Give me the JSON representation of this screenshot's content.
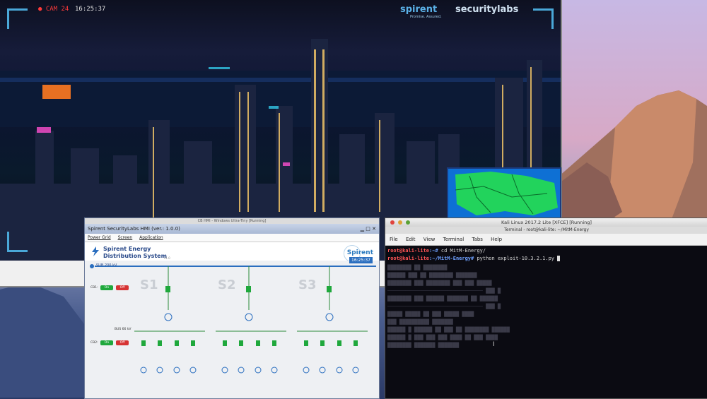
{
  "camera": {
    "rec_label": "CAM 24",
    "clock": "16:25:37",
    "brand_left": "spirent",
    "brand_left_sub": "Promise. Assured.",
    "brand_right": "securitylabs"
  },
  "hmi_window": {
    "outer_title": "CB HMI - Windows Ultra-Tiny [Running]",
    "app_title": "Spirent SecurityLabs HMI (ver.: 1.0.0)",
    "menu": [
      "Power Grid",
      "Screen",
      "Application"
    ],
    "system_title_line1": "Spirent Energy",
    "system_title_line2": "Distribution System",
    "system_version": "v1.0",
    "brand": "Spirent",
    "bus_main_label": "SUB 200 kV",
    "clock": "16:25:37",
    "stations": [
      "S1",
      "S2",
      "S3"
    ],
    "cb1_label": "CB1:",
    "cb2_label": "CB2:",
    "bus_secondary_label": "BUS 66 kV",
    "btn_on": "On",
    "btn_off": "Off"
  },
  "terminal": {
    "window_title": "Kali Linux 2017.2 Lite [XFCE] [Running]",
    "inner_title": "Terminal - root@kali-lite: ~/MitM-Energy",
    "menu": [
      "File",
      "Edit",
      "View",
      "Terminal",
      "Tabs",
      "Help"
    ],
    "line1_user": "root@kali-lite",
    "line1_path": ":~#",
    "line1_cmd": " cd MitM-Energy/",
    "line2_user": "root@kali-lite",
    "line2_path": ":~/MitM-Energy#",
    "line2_cmd": " python exploit-10.3.2.1.py"
  },
  "colors": {
    "accent_blue": "#4aa8d8",
    "prompt_red": "#ff5555",
    "prompt_blue": "#6ea0ff",
    "breaker_green": "#1fa83c",
    "breaker_red": "#d63333"
  }
}
